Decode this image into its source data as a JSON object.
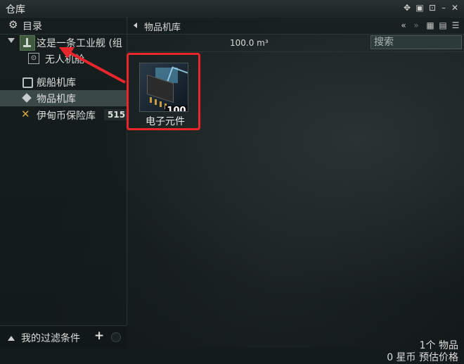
{
  "window": {
    "title": "仓库"
  },
  "sidebar": {
    "header": "目录",
    "ship": "这是一条工业舰 (组",
    "drone_bay": "无人机舱",
    "ship_hangar": "舰船机库",
    "item_hangar": "物品机库",
    "deliveries": "伊甸币保险库",
    "deliveries_count": "515",
    "filter_label": "我的过滤条件"
  },
  "main": {
    "title": "物品机库",
    "volume": "100.0 m³",
    "search_placeholder": "搜索",
    "items": [
      {
        "name": "电子元件",
        "quantity": "100"
      }
    ],
    "footer_count": "1个 物品",
    "footer_price": "0 星币 预估价格"
  },
  "colors": {
    "highlight": "#e8262b",
    "selected_row": "#3a4848"
  }
}
